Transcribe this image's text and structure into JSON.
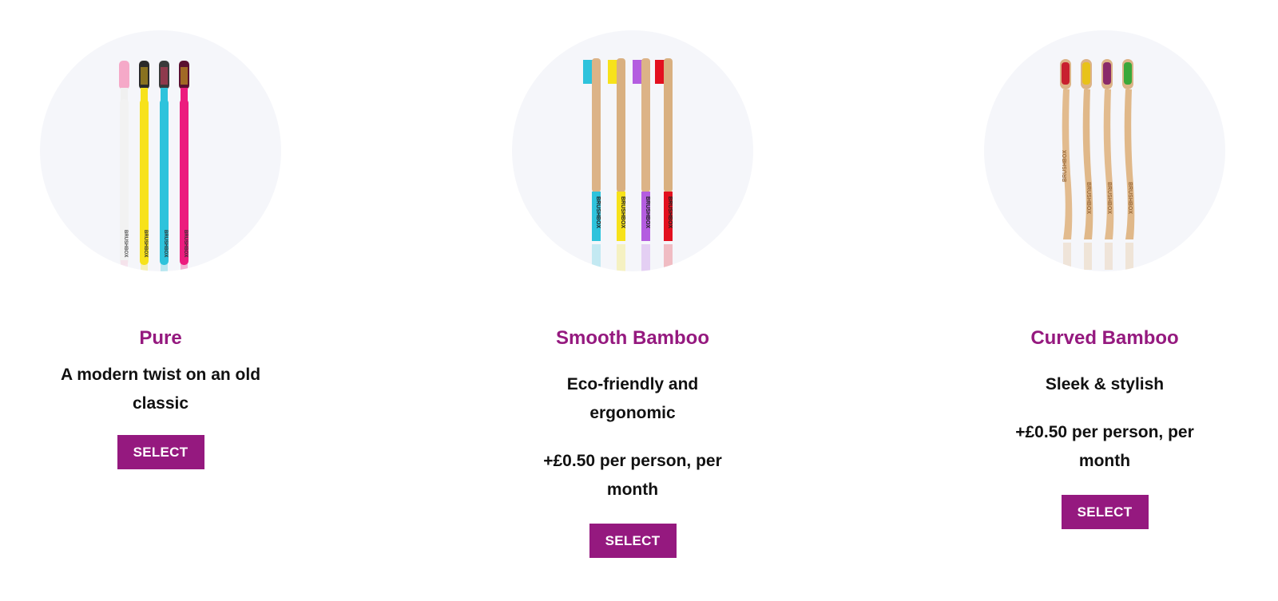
{
  "products": [
    {
      "title": "Pure",
      "description": "A modern twist on an old classic",
      "price": "",
      "button_label": "SELECT",
      "image_icon": "plastic-toothbrushes-image",
      "handle_colors": [
        "#f2f2f2",
        "#f7e21b",
        "#2ec3dc",
        "#ec1c7e"
      ],
      "bristle_colors": [
        "#f5a9c8",
        "#2a2a2a",
        "#3a3a3a",
        "#5a1030"
      ],
      "brand_text": "BRUSHBOX"
    },
    {
      "title": "Smooth Bamboo",
      "description": "Eco-friendly and ergonomic",
      "price": "+£0.50 per person, per month",
      "button_label": "SELECT",
      "image_icon": "smooth-bamboo-toothbrushes-image",
      "band_colors": [
        "#2ec3dc",
        "#f7e21b",
        "#b45de0",
        "#e3101f"
      ],
      "bristle_colors": [
        "#2ec3dc",
        "#f7e21b",
        "#b45de0",
        "#e3101f"
      ],
      "brand_text": "BRUSHBOX"
    },
    {
      "title": "Curved Bamboo",
      "description": "Sleek & stylish",
      "price": "+£0.50 per person, per month",
      "button_label": "SELECT",
      "image_icon": "curved-bamboo-toothbrushes-image",
      "bristle_colors": [
        "#c8202f",
        "#e8c21a",
        "#8a2a6a",
        "#3aa83a"
      ],
      "brand_text": "BRUSHBOX"
    }
  ],
  "colors": {
    "accent": "#95197f",
    "circle_bg": "#f5f6fa",
    "bamboo": "#dcb387"
  }
}
